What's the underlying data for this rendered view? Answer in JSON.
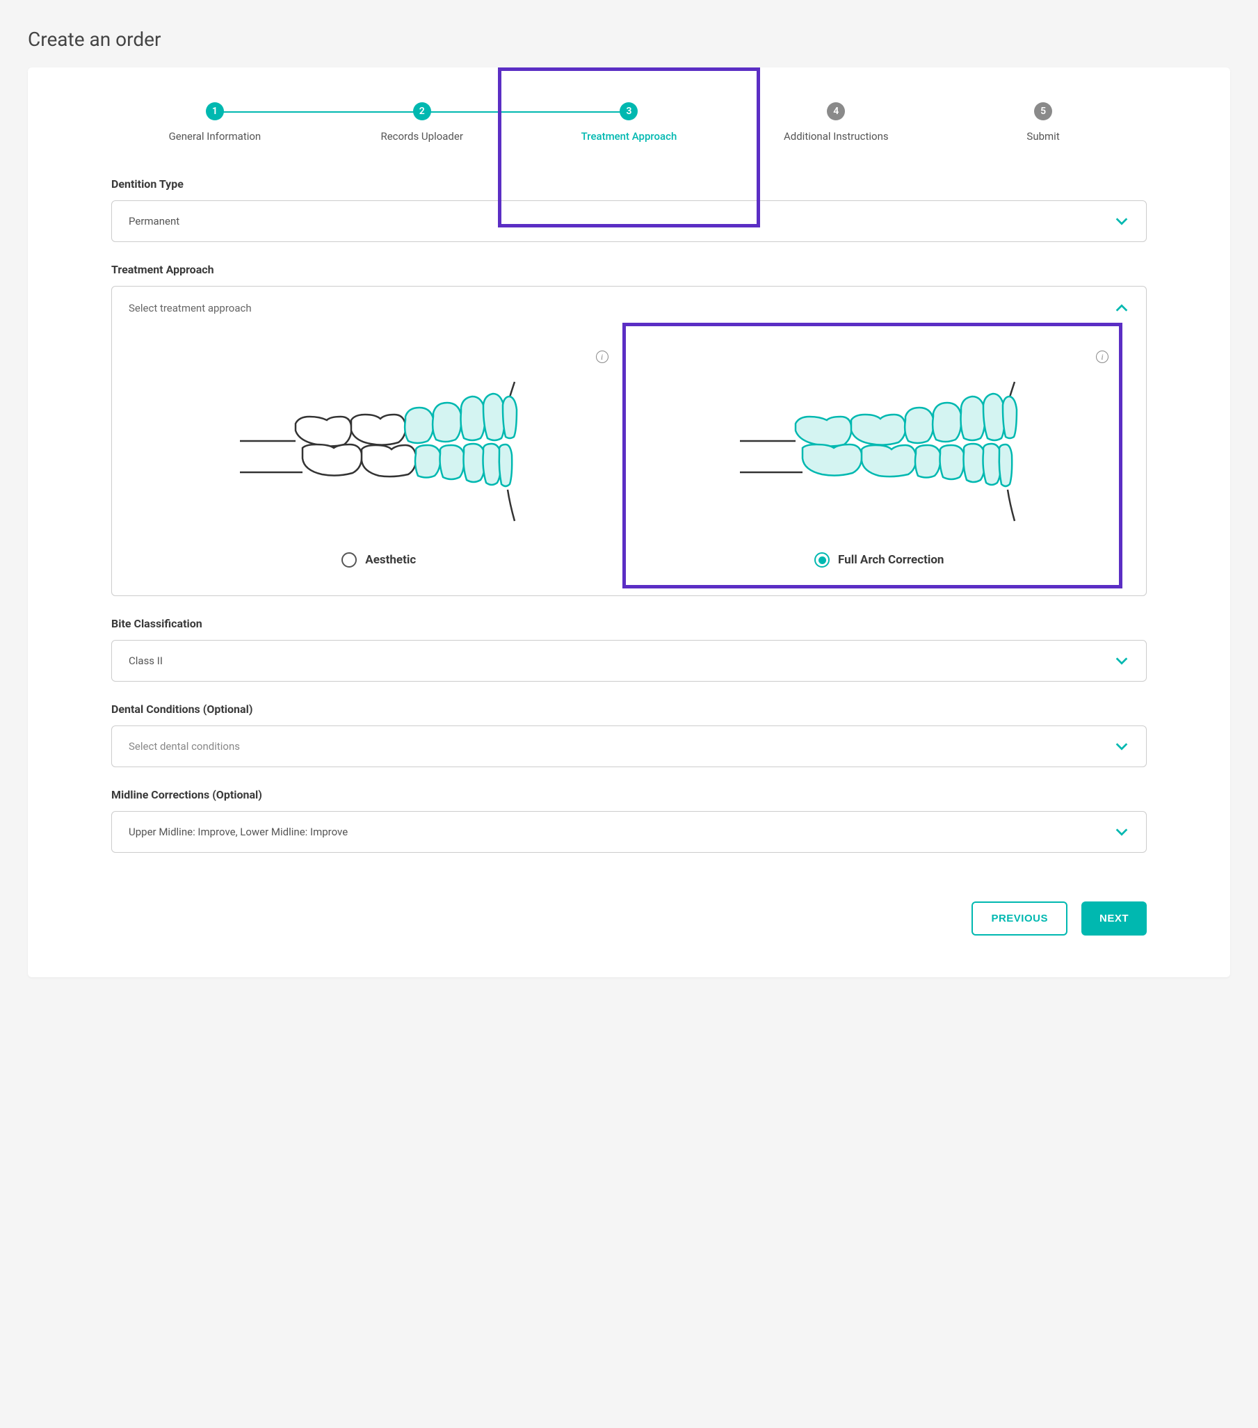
{
  "page_title": "Create an order",
  "stepper": {
    "steps": [
      {
        "num": "1",
        "label": "General Information",
        "state": "done"
      },
      {
        "num": "2",
        "label": "Records Uploader",
        "state": "done"
      },
      {
        "num": "3",
        "label": "Treatment Approach",
        "state": "active"
      },
      {
        "num": "4",
        "label": "Additional Instructions",
        "state": "todo"
      },
      {
        "num": "5",
        "label": "Submit",
        "state": "todo"
      }
    ]
  },
  "sections": {
    "dentition": {
      "label": "Dentition Type",
      "value": "Permanent"
    },
    "treatment_approach": {
      "label": "Treatment Approach",
      "header": "Select treatment approach",
      "options": {
        "aesthetic": "Aesthetic",
        "full_arch": "Full Arch Correction"
      },
      "selected": "full_arch"
    },
    "bite": {
      "label": "Bite Classification",
      "value": "Class II"
    },
    "dental_conditions": {
      "label": "Dental Conditions (Optional)",
      "placeholder": "Select dental conditions"
    },
    "midline": {
      "label": "Midline Corrections (Optional)",
      "value": "Upper Midline: Improve, Lower Midline: Improve"
    }
  },
  "buttons": {
    "previous": "PREVIOUS",
    "next": "NEXT"
  },
  "colors": {
    "accent": "#00b8b0",
    "highlight": "#5b2ec4"
  }
}
